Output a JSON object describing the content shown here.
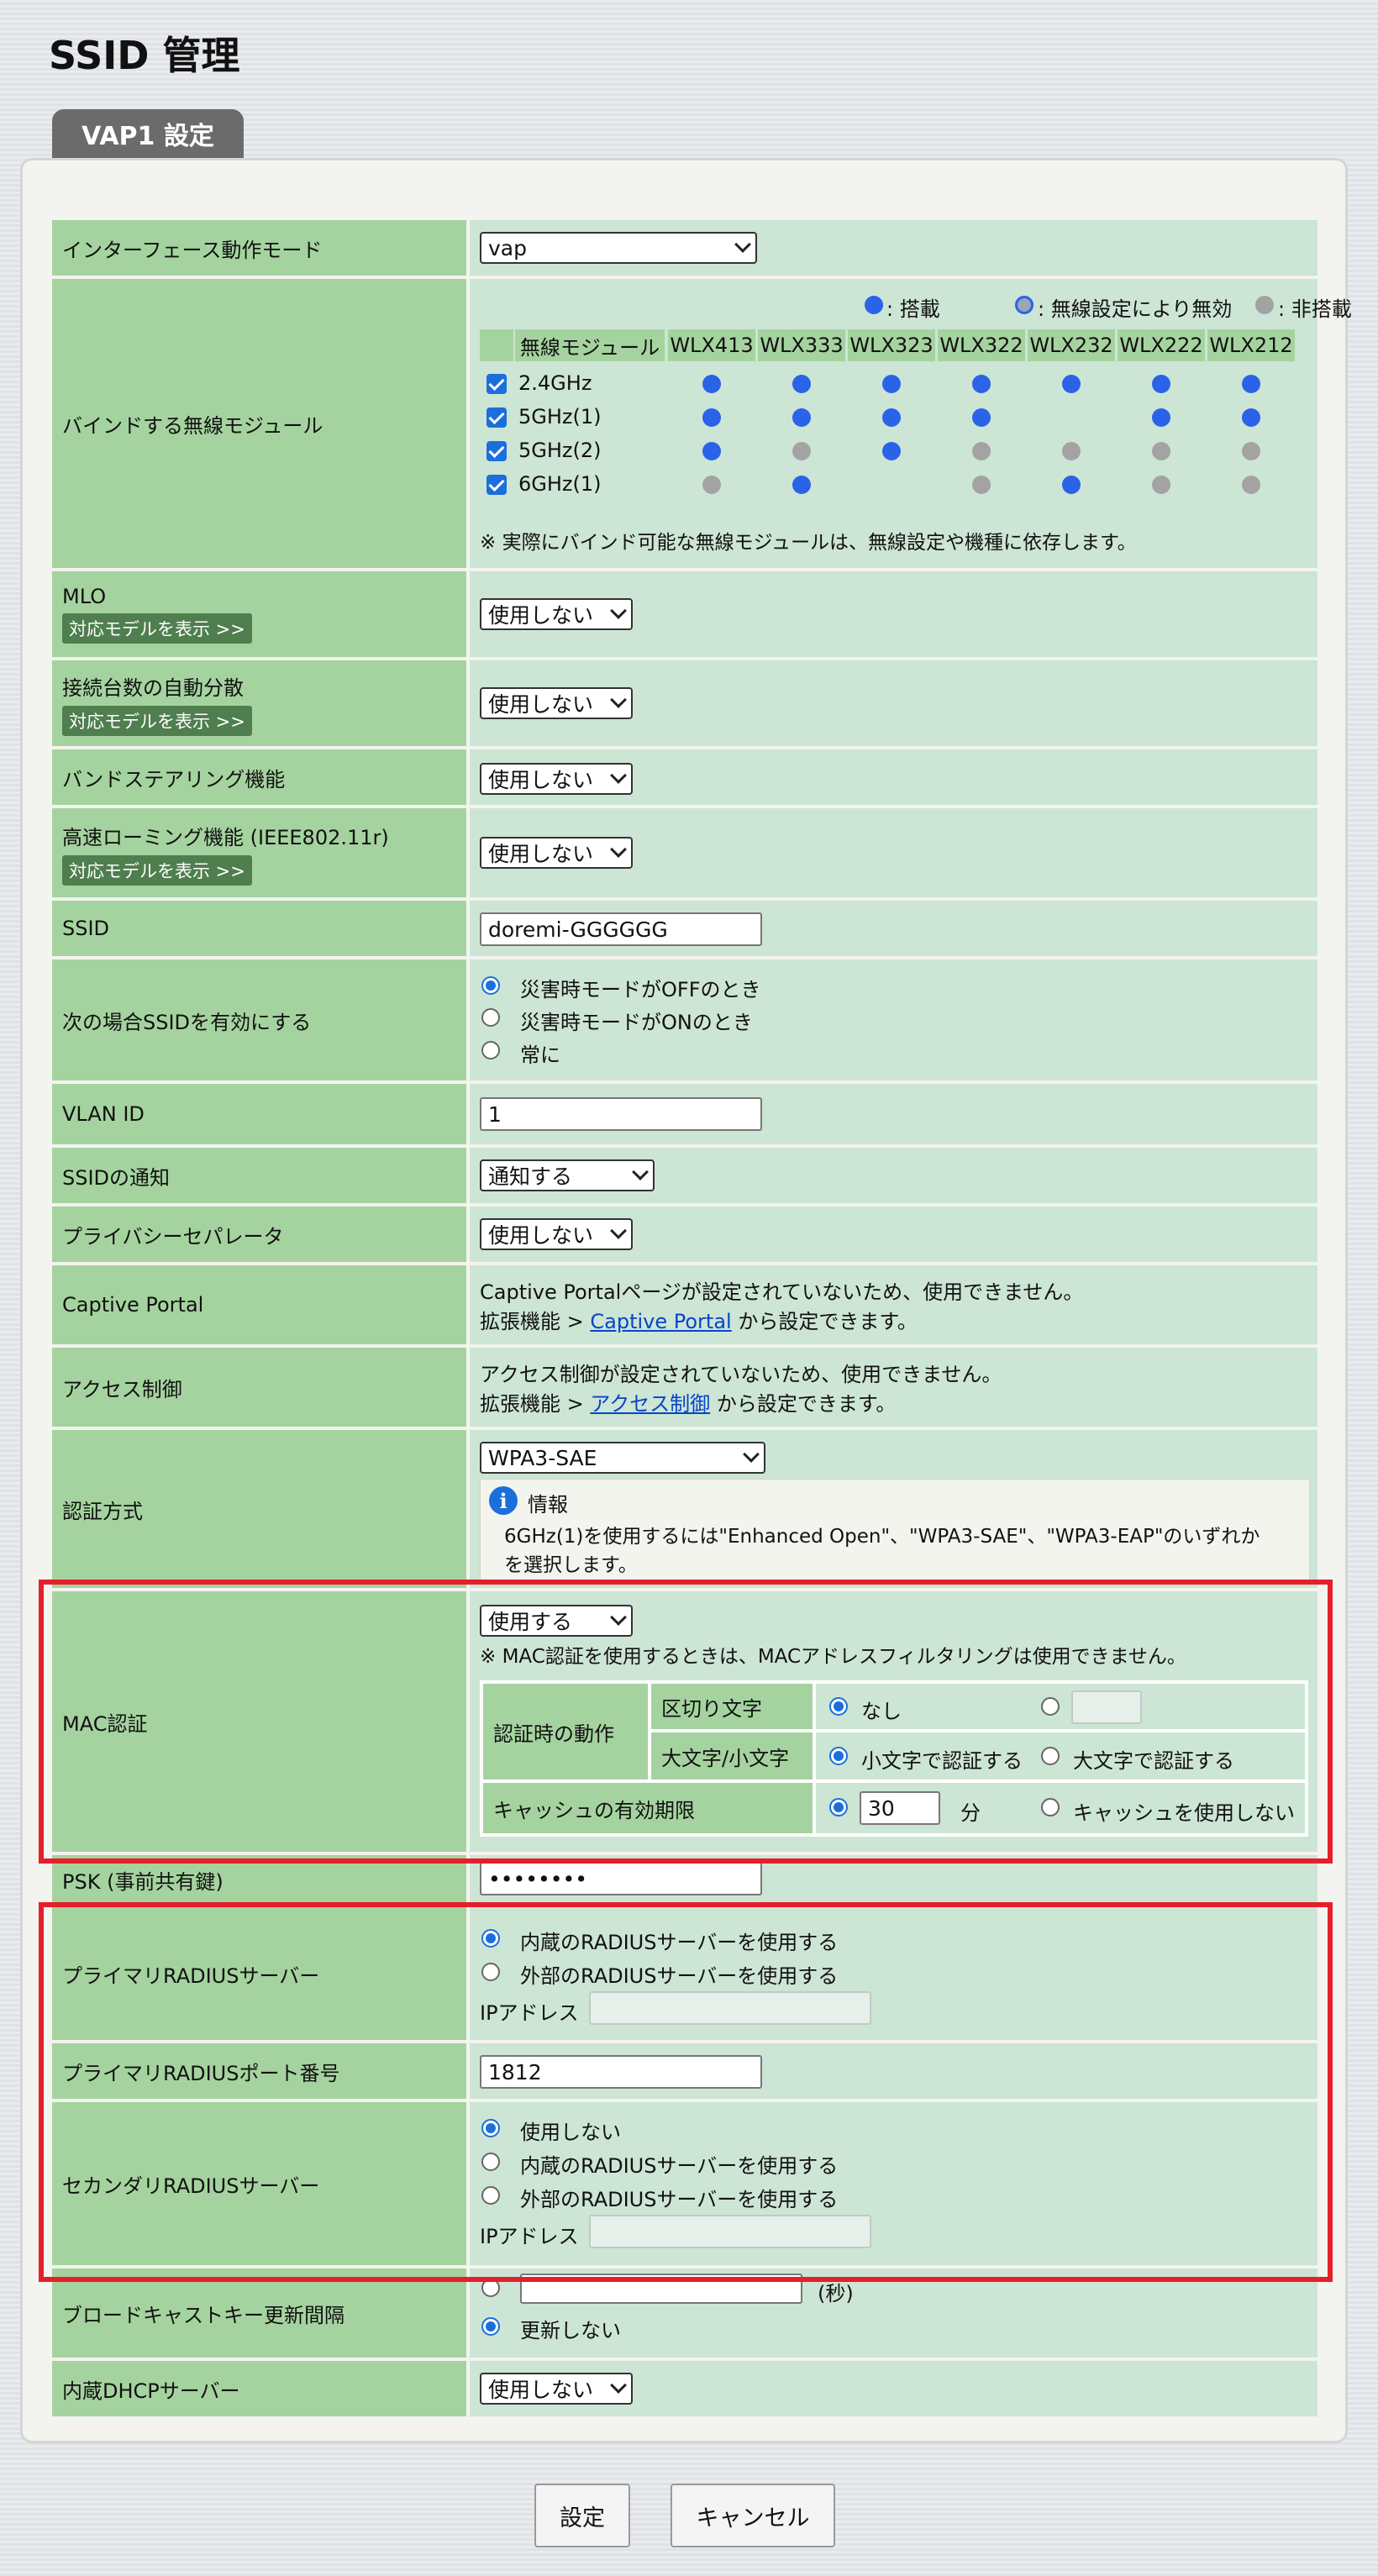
{
  "page": {
    "title": "SSID 管理",
    "tab": "VAP1 設定"
  },
  "rows": {
    "interface_mode": {
      "label": "インターフェース動作モード",
      "value": "vap"
    },
    "bind_module": {
      "label": "バインドする無線モジュール",
      "legend": {
        "on": ": 搭載",
        "disabled": ": 無線設定により無効",
        "off": ": 非搭載"
      },
      "header": "無線モジュール",
      "models": [
        "WLX413",
        "WLX333",
        "WLX323",
        "WLX322",
        "WLX232",
        "WLX222",
        "WLX212"
      ],
      "bands": [
        {
          "name": "2.4GHz",
          "checked": true,
          "states": [
            "on",
            "on",
            "on",
            "on",
            "on",
            "on",
            "on"
          ]
        },
        {
          "name": "5GHz(1)",
          "checked": true,
          "states": [
            "on",
            "on",
            "on",
            "on",
            "disabled",
            "on",
            "on"
          ]
        },
        {
          "name": "5GHz(2)",
          "checked": true,
          "states": [
            "on",
            "off",
            "on",
            "off",
            "off",
            "off",
            "off"
          ]
        },
        {
          "name": "6GHz(1)",
          "checked": true,
          "states": [
            "off",
            "on",
            "disabled",
            "off",
            "on",
            "off",
            "off"
          ]
        }
      ],
      "note": "※ 実際にバインド可能な無線モジュールは、無線設定や機種に依存します。"
    },
    "mlo": {
      "label": "MLO",
      "badge": "対応モデルを表示 >>",
      "value": "使用しない"
    },
    "load_balance": {
      "label": "接続台数の自動分散",
      "badge": "対応モデルを表示 >>",
      "value": "使用しない"
    },
    "band_steering": {
      "label": "バンドステアリング機能",
      "value": "使用しない"
    },
    "fast_roaming": {
      "label": "高速ローミング機能 (IEEE802.11r)",
      "badge": "対応モデルを表示 >>",
      "value": "使用しない"
    },
    "ssid": {
      "label": "SSID",
      "value": "doremi-GGGGGG"
    },
    "ssid_enable": {
      "label": "次の場合SSIDを有効にする",
      "options": [
        "災害時モードがOFFのとき",
        "災害時モードがONのとき",
        "常に"
      ],
      "selected": 0
    },
    "vlan": {
      "label": "VLAN ID",
      "value": "1"
    },
    "ssid_notify": {
      "label": "SSIDの通知",
      "value": "通知する"
    },
    "privacy": {
      "label": "プライバシーセパレータ",
      "value": "使用しない"
    },
    "captive": {
      "label": "Captive Portal",
      "line1": "Captive Portalページが設定されていないため、使用できません。",
      "line2_prefix": "拡張機能 > ",
      "link": "Captive Portal",
      "line2_suffix": " から設定できます。"
    },
    "access": {
      "label": "アクセス制御",
      "line1": "アクセス制御が設定されていないため、使用できません。",
      "line2_prefix": "拡張機能 > ",
      "link": "アクセス制御",
      "line2_suffix": " から設定できます。"
    },
    "auth": {
      "label": "認証方式",
      "value": "WPA3-SAE",
      "info_title": "情報",
      "info_line1": "6GHz(1)を使用するには\"Enhanced Open\"、\"WPA3-SAE\"、\"WPA3-EAP\"のいずれか",
      "info_line2": "を選択します。"
    },
    "mac_auth": {
      "label": "MAC認証",
      "value": "使用する",
      "note": "※ MAC認証を使用するときは、MACアドレスフィルタリングは使用できません。",
      "action_label": "認証時の動作",
      "delimiter_label": "区切り文字",
      "delimiter_none": "なし",
      "case_label": "大文字/小文字",
      "case_lower": "小文字で認証する",
      "case_upper": "大文字で認証する",
      "cache_label": "キャッシュの有効期限",
      "cache_value": "30",
      "cache_unit": "分",
      "cache_none": "キャッシュを使用しない"
    },
    "psk": {
      "label": "PSK (事前共有鍵)",
      "value": "••••••••"
    },
    "primary_radius": {
      "label": "プライマリRADIUSサーバー",
      "opt1": "内蔵のRADIUSサーバーを使用する",
      "opt2": "外部のRADIUSサーバーを使用する",
      "ip_label": "IPアドレス"
    },
    "primary_port": {
      "label": "プライマリRADIUSポート番号",
      "value": "1812"
    },
    "secondary_radius": {
      "label": "セカンダリRADIUSサーバー",
      "opt0": "使用しない",
      "opt1": "内蔵のRADIUSサーバーを使用する",
      "opt2": "外部のRADIUSサーバーを使用する",
      "ip_label": "IPアドレス"
    },
    "broadcast_key": {
      "label": "ブロードキャストキー更新間隔",
      "unit": "(秒)",
      "no_update": "更新しない"
    },
    "dhcp": {
      "label": "内蔵DHCPサーバー",
      "value": "使用しない"
    }
  },
  "buttons": {
    "submit": "設定",
    "cancel": "キャンセル"
  },
  "colors": {
    "label_bg": "#a5d39f",
    "value_bg": "#cde5d5",
    "accent": "#1a6fdc",
    "highlight": "#e41f2b"
  }
}
